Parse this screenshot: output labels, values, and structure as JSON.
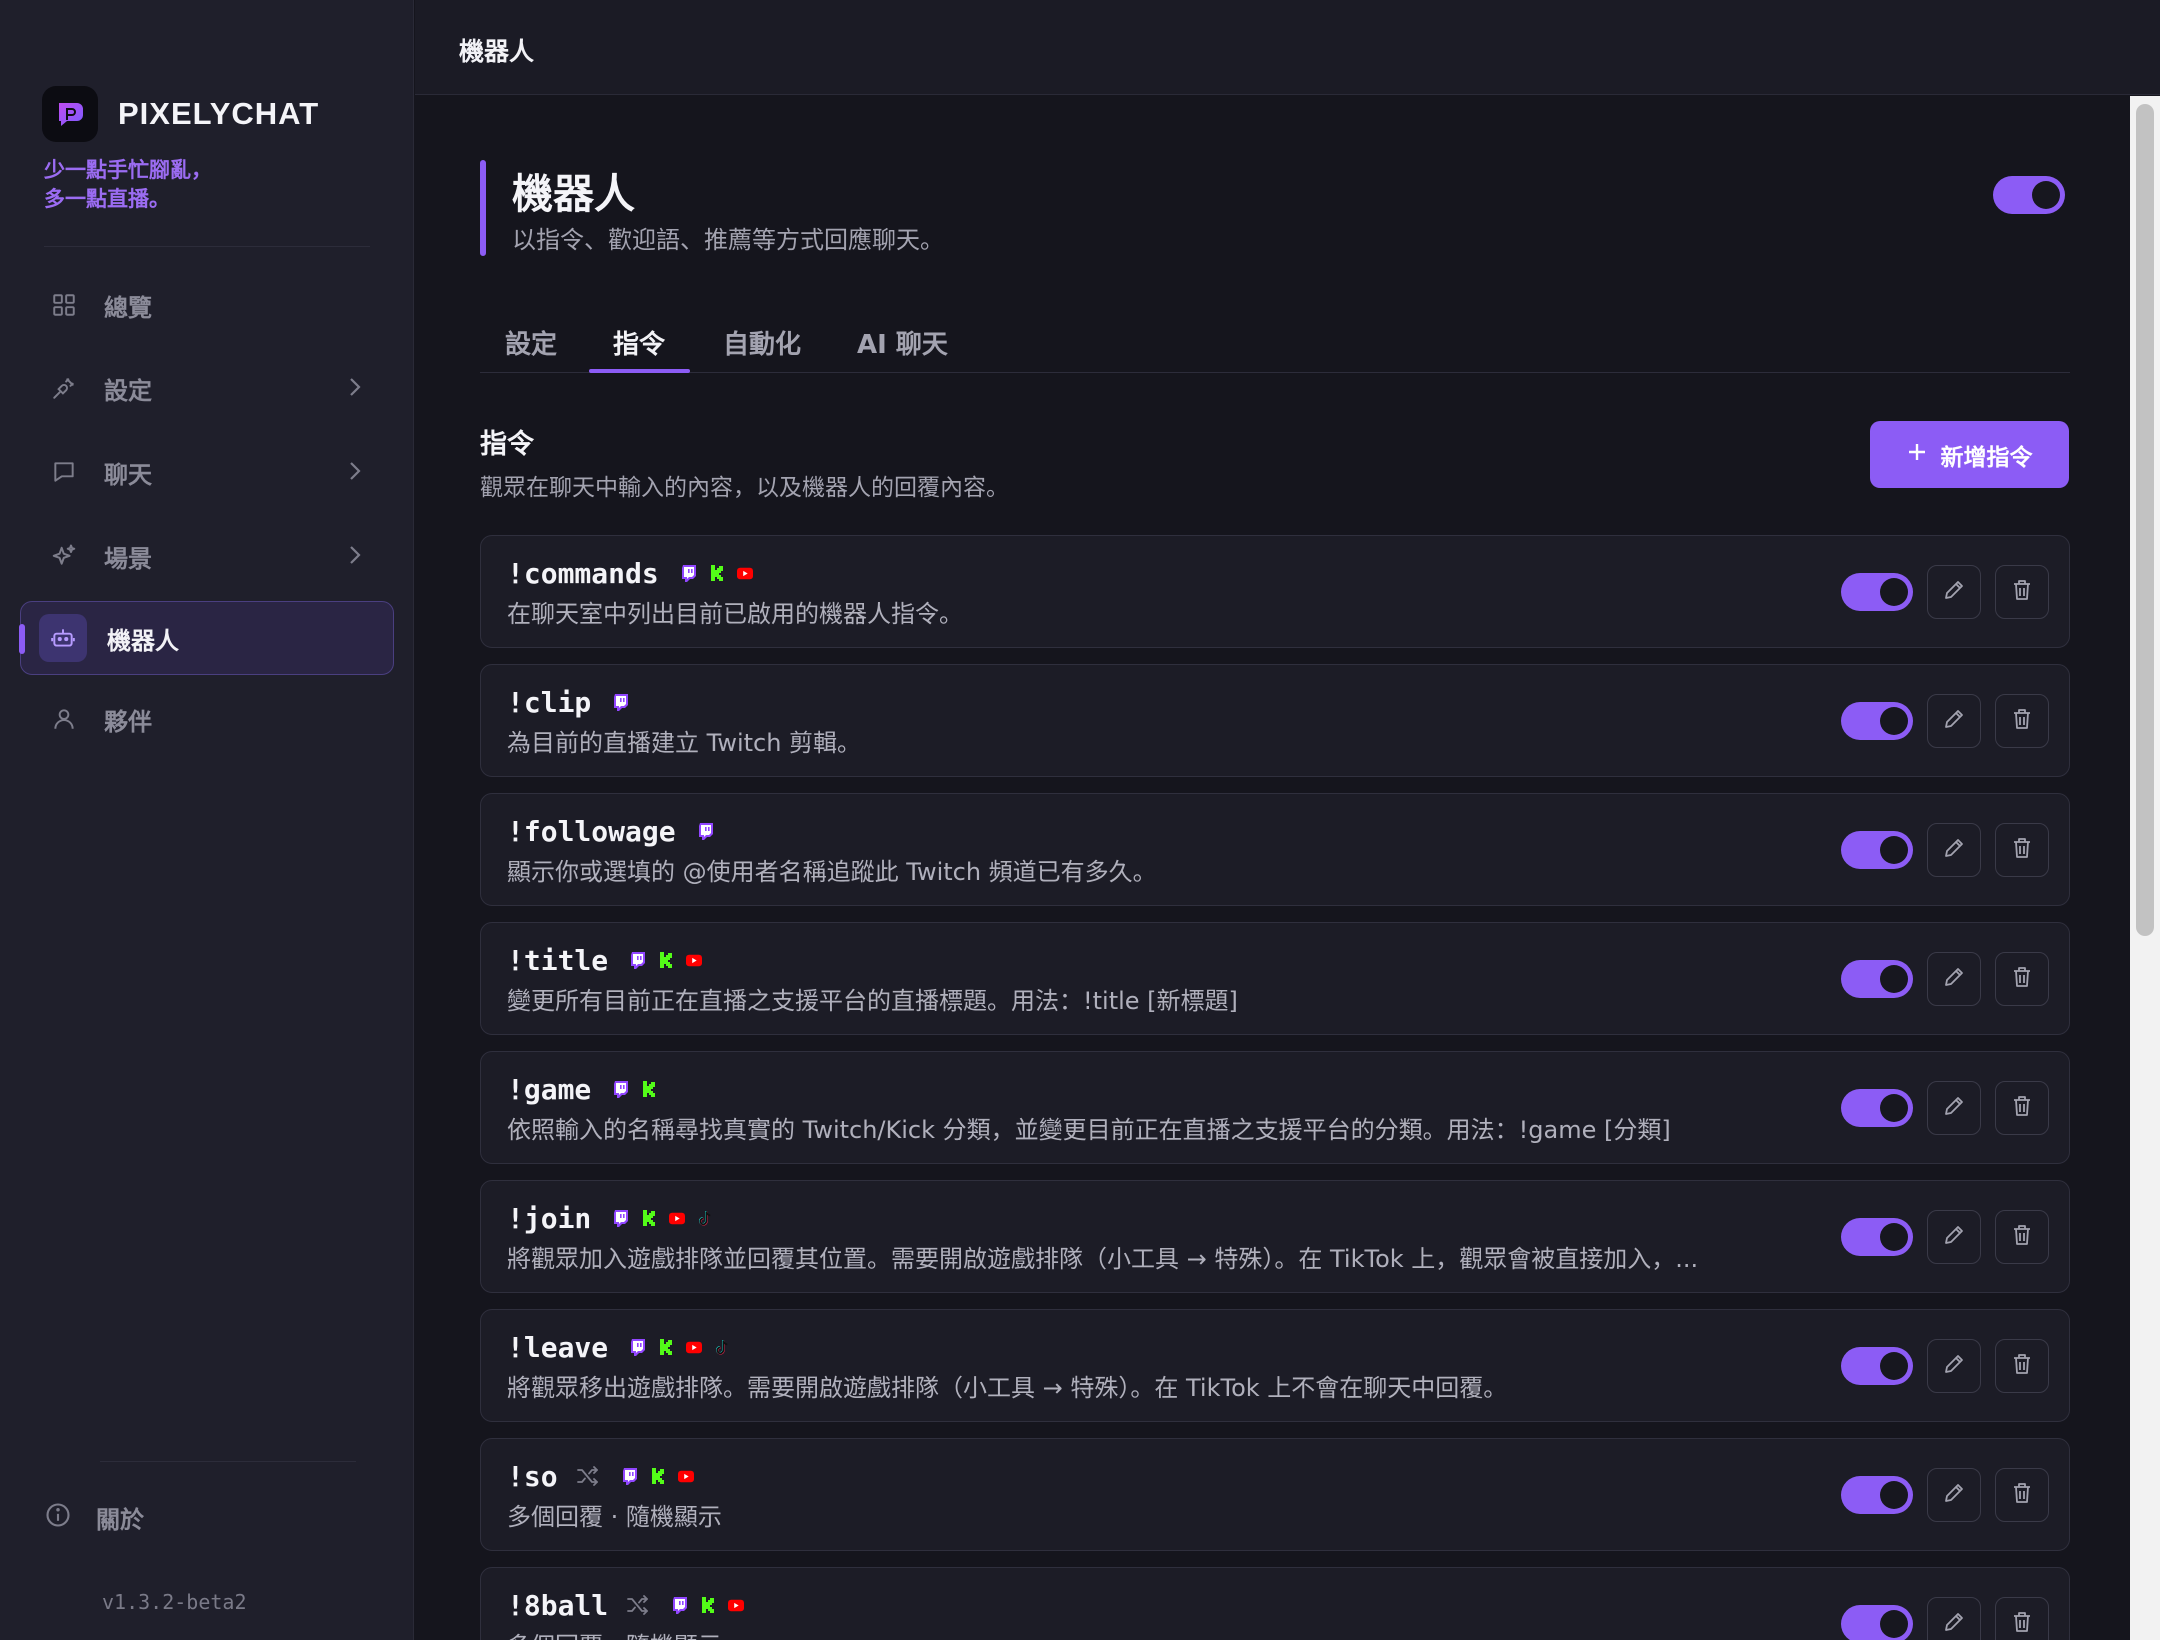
{
  "topbar": {
    "title": "機器人"
  },
  "sidebar": {
    "brand": "PIXELYCHAT",
    "tagline_line1": "少一點手忙腳亂，",
    "tagline_line2": "多一點直播。",
    "items": [
      {
        "label": "總覽",
        "icon": "grid-icon"
      },
      {
        "label": "設定",
        "icon": "plug-icon"
      },
      {
        "label": "聊天",
        "icon": "chat-bubble-icon"
      },
      {
        "label": "場景",
        "icon": "sparkles-icon"
      },
      {
        "label": "機器人",
        "icon": "bot-icon",
        "active": true
      },
      {
        "label": "夥伴",
        "icon": "user-icon"
      }
    ],
    "about": "關於",
    "version": "v1.3.2-beta2"
  },
  "page": {
    "title": "機器人",
    "subtitle": "以指令、歡迎語、推薦等方式回應聊天。",
    "enabled": true
  },
  "tabs": [
    {
      "label": "設定"
    },
    {
      "label": "指令",
      "active": true
    },
    {
      "label": "自動化"
    },
    {
      "label": "AI 聊天"
    }
  ],
  "section": {
    "title": "指令",
    "subtitle": "觀眾在聊天中輸入的內容，以及機器人的回覆內容。",
    "add_button": "新增指令"
  },
  "commands": [
    {
      "name": "!commands",
      "desc": "在聊天室中列出目前已啟用的機器人指令。",
      "platforms": [
        "twitch",
        "kick",
        "youtube"
      ],
      "random": false,
      "enabled": true
    },
    {
      "name": "!clip",
      "desc": "為目前的直播建立 Twitch 剪輯。",
      "platforms": [
        "twitch"
      ],
      "random": false,
      "enabled": true
    },
    {
      "name": "!followage",
      "desc": "顯示你或選填的 @使用者名稱追蹤此 Twitch 頻道已有多久。",
      "platforms": [
        "twitch"
      ],
      "random": false,
      "enabled": true
    },
    {
      "name": "!title",
      "desc": "變更所有目前正在直播之支援平台的直播標題。用法：!title [新標題]",
      "platforms": [
        "twitch",
        "kick",
        "youtube"
      ],
      "random": false,
      "enabled": true
    },
    {
      "name": "!game",
      "desc": "依照輸入的名稱尋找真實的 Twitch/Kick 分類，並變更目前正在直播之支援平台的分類。用法：!game [分類]",
      "platforms": [
        "twitch",
        "kick"
      ],
      "random": false,
      "enabled": true
    },
    {
      "name": "!join",
      "desc": "將觀眾加入遊戲排隊並回覆其位置。需要開啟遊戲排隊（小工具 → 特殊）。在 TikTok 上，觀眾會被直接加入，...",
      "platforms": [
        "twitch",
        "kick",
        "youtube",
        "tiktok"
      ],
      "random": false,
      "enabled": true
    },
    {
      "name": "!leave",
      "desc": "將觀眾移出遊戲排隊。需要開啟遊戲排隊（小工具 → 特殊）。在 TikTok 上不會在聊天中回覆。",
      "platforms": [
        "twitch",
        "kick",
        "youtube",
        "tiktok"
      ],
      "random": false,
      "enabled": true
    },
    {
      "name": "!so",
      "desc": "多個回覆 · 隨機顯示",
      "platforms": [
        "twitch",
        "kick",
        "youtube"
      ],
      "random": true,
      "enabled": true
    },
    {
      "name": "!8ball",
      "desc": "多個回覆 · 隨機顯示",
      "platforms": [
        "twitch",
        "kick",
        "youtube"
      ],
      "random": true,
      "enabled": true
    }
  ],
  "colors": {
    "accent": "#8c5cf5",
    "twitch": "#9146ff",
    "kick": "#53fc18",
    "youtube": "#ff0000"
  }
}
